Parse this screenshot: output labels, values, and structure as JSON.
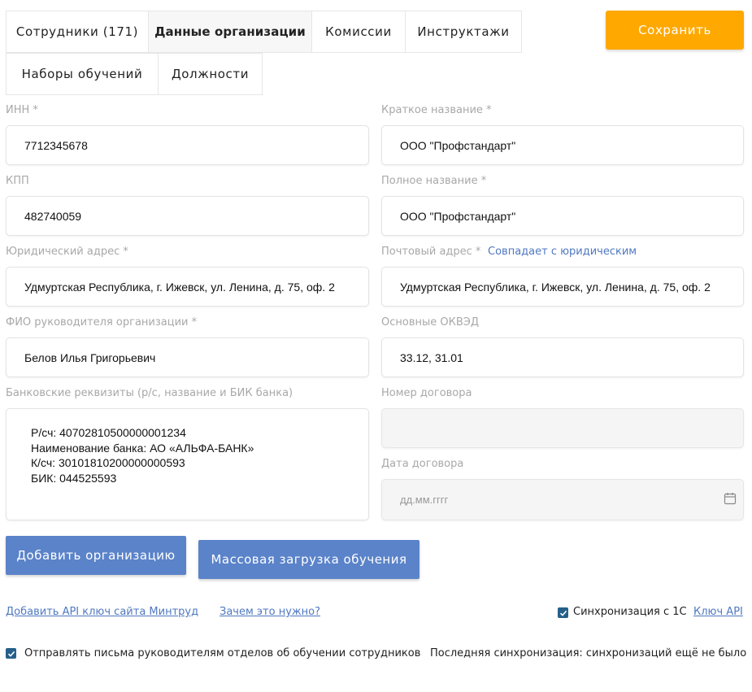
{
  "tabs": [
    {
      "label": "Сотрудники (171)",
      "active": false
    },
    {
      "label": "Данные организации",
      "active": true
    },
    {
      "label": "Комиссии",
      "active": false
    },
    {
      "label": "Инструктажи",
      "active": false
    },
    {
      "label": "Наборы обучений",
      "active": false
    },
    {
      "label": "Должности",
      "active": false
    }
  ],
  "save_label": "Сохранить",
  "form": {
    "inn": {
      "label": "ИНН *",
      "value": "7712345678"
    },
    "short_name": {
      "label": "Краткое название *",
      "value": "ООО \"Профстандарт\""
    },
    "kpp": {
      "label": "КПП",
      "value": "482740059"
    },
    "full_name": {
      "label": "Полное название *",
      "value": "ООО \"Профстандарт\""
    },
    "legal_address": {
      "label": "Юридический адрес *",
      "value": "Удмуртская Республика, г. Ижевск, ул. Ленина, д. 75, оф. 2"
    },
    "postal_address": {
      "label": "Почтовый адрес *",
      "same_link": "Совпадает с юридическим",
      "value": "Удмуртская Республика, г. Ижевск, ул. Ленина, д. 75, оф. 2"
    },
    "director": {
      "label": "ФИО руководителя организации *",
      "value": "Белов Илья Григорьевич"
    },
    "okved": {
      "label": "Основные ОКВЭД",
      "value": "33.12, 31.01"
    },
    "bank": {
      "label": "Банковские реквизиты (р/с, название и БИК банка)",
      "value": "Р/сч: 40702810500000001234\nНаименование банка: АО «АЛЬФА-БАНК»\nК/сч: 30101810200000000593\nБИК: 044525593"
    },
    "contract_number": {
      "label": "Номер договора",
      "value": ""
    },
    "contract_date": {
      "label": "Дата договора",
      "placeholder": "дд.мм.гггг"
    }
  },
  "buttons": {
    "add_org": "Добавить организацию",
    "bulk_upload": "Массовая загрузка обучения"
  },
  "links": {
    "mintrud_api": "Добавить API ключ сайта Минтруд",
    "why": "Зачем это нужно?",
    "api_key": "Ключ API"
  },
  "sync": {
    "label": "Синхронизация с 1С",
    "checked": true,
    "last": "Последняя синхронизация: синхронизаций ещё не было"
  },
  "notify": {
    "label": "Отправлять письма руководителям отделов об обучении сотрудников",
    "checked": true
  },
  "colors": {
    "accent": "#ffa800",
    "primary": "#5b83c9",
    "link": "#4f78c0",
    "checkbox": "#24608a"
  }
}
